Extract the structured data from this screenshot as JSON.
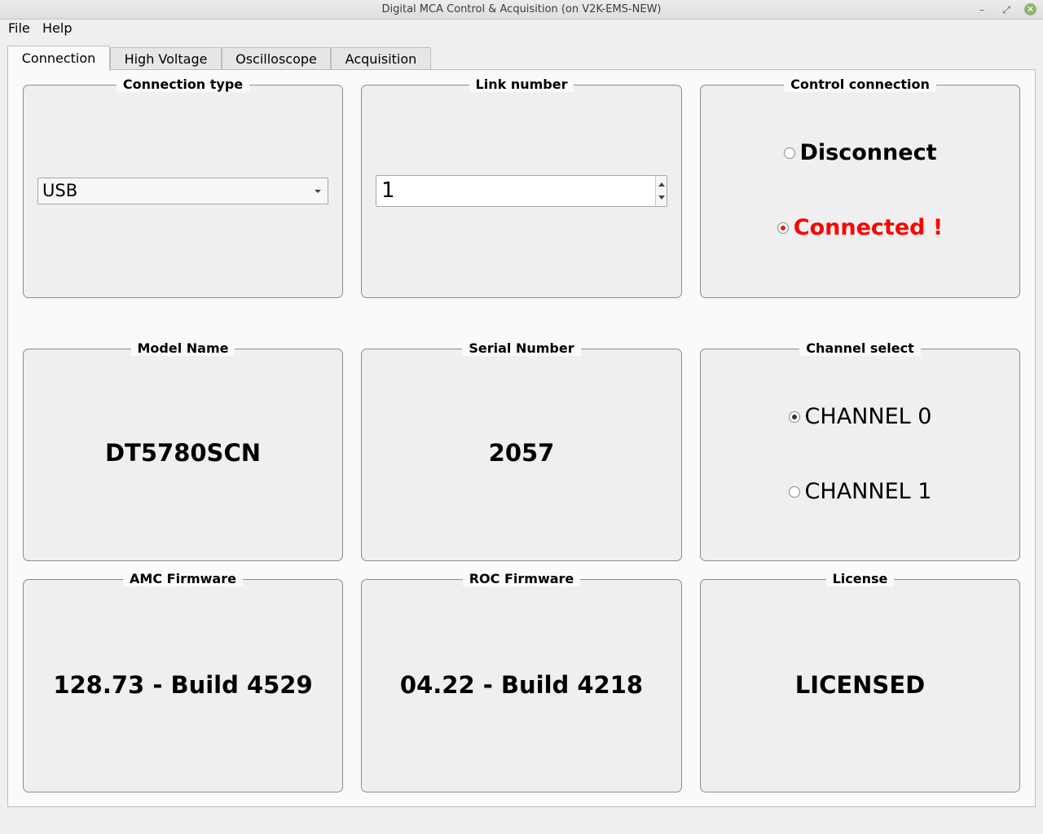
{
  "window": {
    "title": "Digital MCA Control & Acquisition (on V2K-EMS-NEW)"
  },
  "menu": {
    "items": [
      "File",
      "Help"
    ]
  },
  "tabs": [
    {
      "label": "Connection",
      "active": true
    },
    {
      "label": "High Voltage",
      "active": false
    },
    {
      "label": "Oscilloscope",
      "active": false
    },
    {
      "label": "Acquisition",
      "active": false
    }
  ],
  "groups": {
    "connection_type": {
      "title": "Connection type",
      "value": "USB"
    },
    "link_number": {
      "title": "Link number",
      "value": "1"
    },
    "control_connection": {
      "title": "Control connection",
      "disconnect_label": "Disconnect",
      "connected_label": "Connected !",
      "selected": "connected",
      "connected_color": "#ff0000"
    },
    "model_name": {
      "title": "Model Name",
      "value": "DT5780SCN"
    },
    "serial_number": {
      "title": "Serial Number",
      "value": "2057"
    },
    "channel_select": {
      "title": "Channel select",
      "options": [
        "CHANNEL 0",
        "CHANNEL 1"
      ],
      "selected_index": 0
    },
    "amc_firmware": {
      "title": "AMC Firmware",
      "value": "128.73 - Build 4529"
    },
    "roc_firmware": {
      "title": "ROC Firmware",
      "value": "04.22 - Build 4218"
    },
    "license": {
      "title": "License",
      "value": "LICENSED"
    }
  }
}
